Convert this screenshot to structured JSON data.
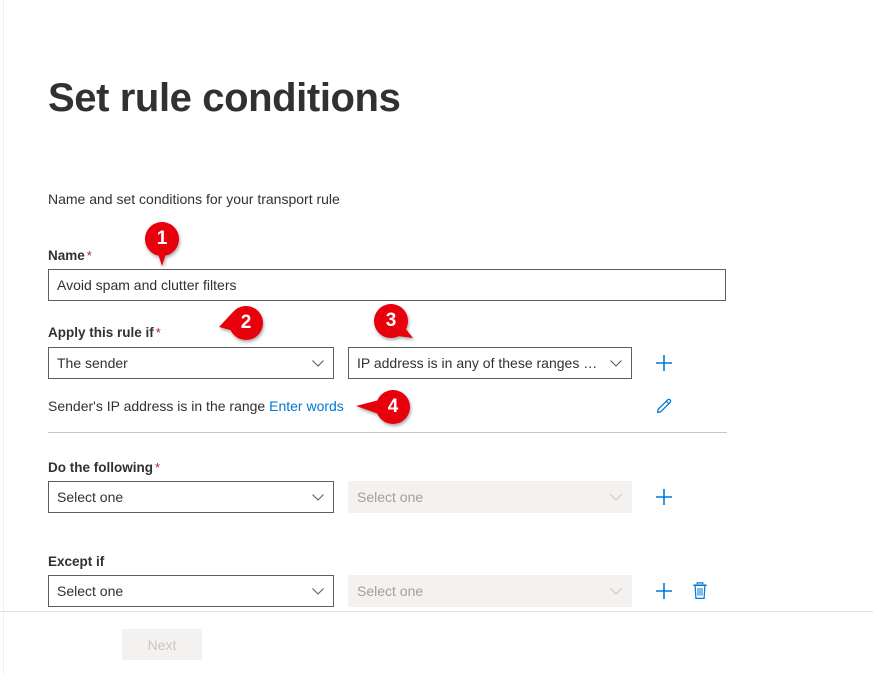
{
  "page": {
    "title": "Set rule conditions",
    "subtitle": "Name and set conditions for your transport rule"
  },
  "form": {
    "name_field": {
      "label": "Name",
      "required_mark": "*",
      "value": "Avoid spam and clutter filters",
      "placeholder": ""
    },
    "apply_rule_if": {
      "label": "Apply this rule if",
      "required_mark": "*",
      "primary_dropdown": "The sender",
      "secondary_dropdown": "IP address is in any of these ranges or ...",
      "add_label": "+"
    },
    "condition_summary": {
      "text": "Sender's IP address is in the range",
      "link": "Enter words"
    },
    "do_the_following": {
      "label": "Do the following",
      "required_mark": "*",
      "primary_dropdown": "Select one",
      "secondary_dropdown": "Select one",
      "add_label": "+"
    },
    "except_if": {
      "label": "Except if",
      "required_mark": "",
      "primary_dropdown": "Select one",
      "secondary_dropdown": "Select one",
      "add_label": "+"
    }
  },
  "footer": {
    "next_button": "Next"
  },
  "markers": [
    {
      "number": "1"
    },
    {
      "number": "2"
    },
    {
      "number": "3"
    },
    {
      "number": "4"
    }
  ],
  "colors": {
    "accent_blue": "#0078d4",
    "marker_red": "#e8000d",
    "required_red": "#a4262c",
    "text": "#323130",
    "disabled_bg": "#f3f2f1",
    "disabled_text": "#a19f9d",
    "border": "#605e5c",
    "divider": "#c8c6c4"
  },
  "icons": {
    "chevron_down": "chevron-down-icon",
    "plus": "plus-icon",
    "pencil": "pencil-icon",
    "trash": "trash-icon"
  }
}
